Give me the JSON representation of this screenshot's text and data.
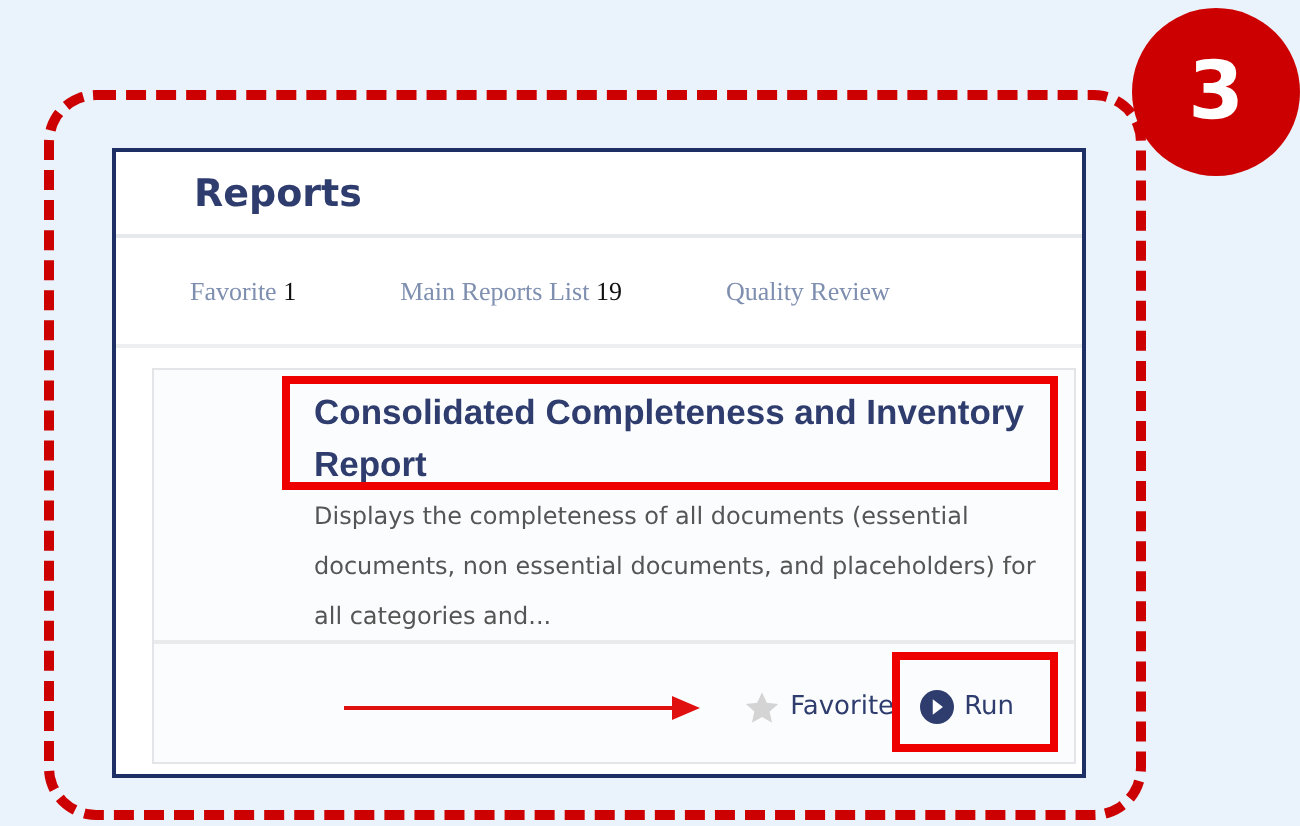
{
  "step_badge": "3",
  "panel": {
    "title": "Reports"
  },
  "tabs": [
    {
      "label": "Favorite",
      "count": "1"
    },
    {
      "label": "Main Reports List",
      "count": "19"
    },
    {
      "label": "Quality Review"
    }
  ],
  "report": {
    "title": "Consolidated Completeness and Inventory Report",
    "description": "Displays the completeness of all documents (essential documents, non essential documents, and placeholders) for all categories and...",
    "favorite": {
      "label": "Favorite",
      "checked": false
    },
    "run_label": "Run"
  }
}
